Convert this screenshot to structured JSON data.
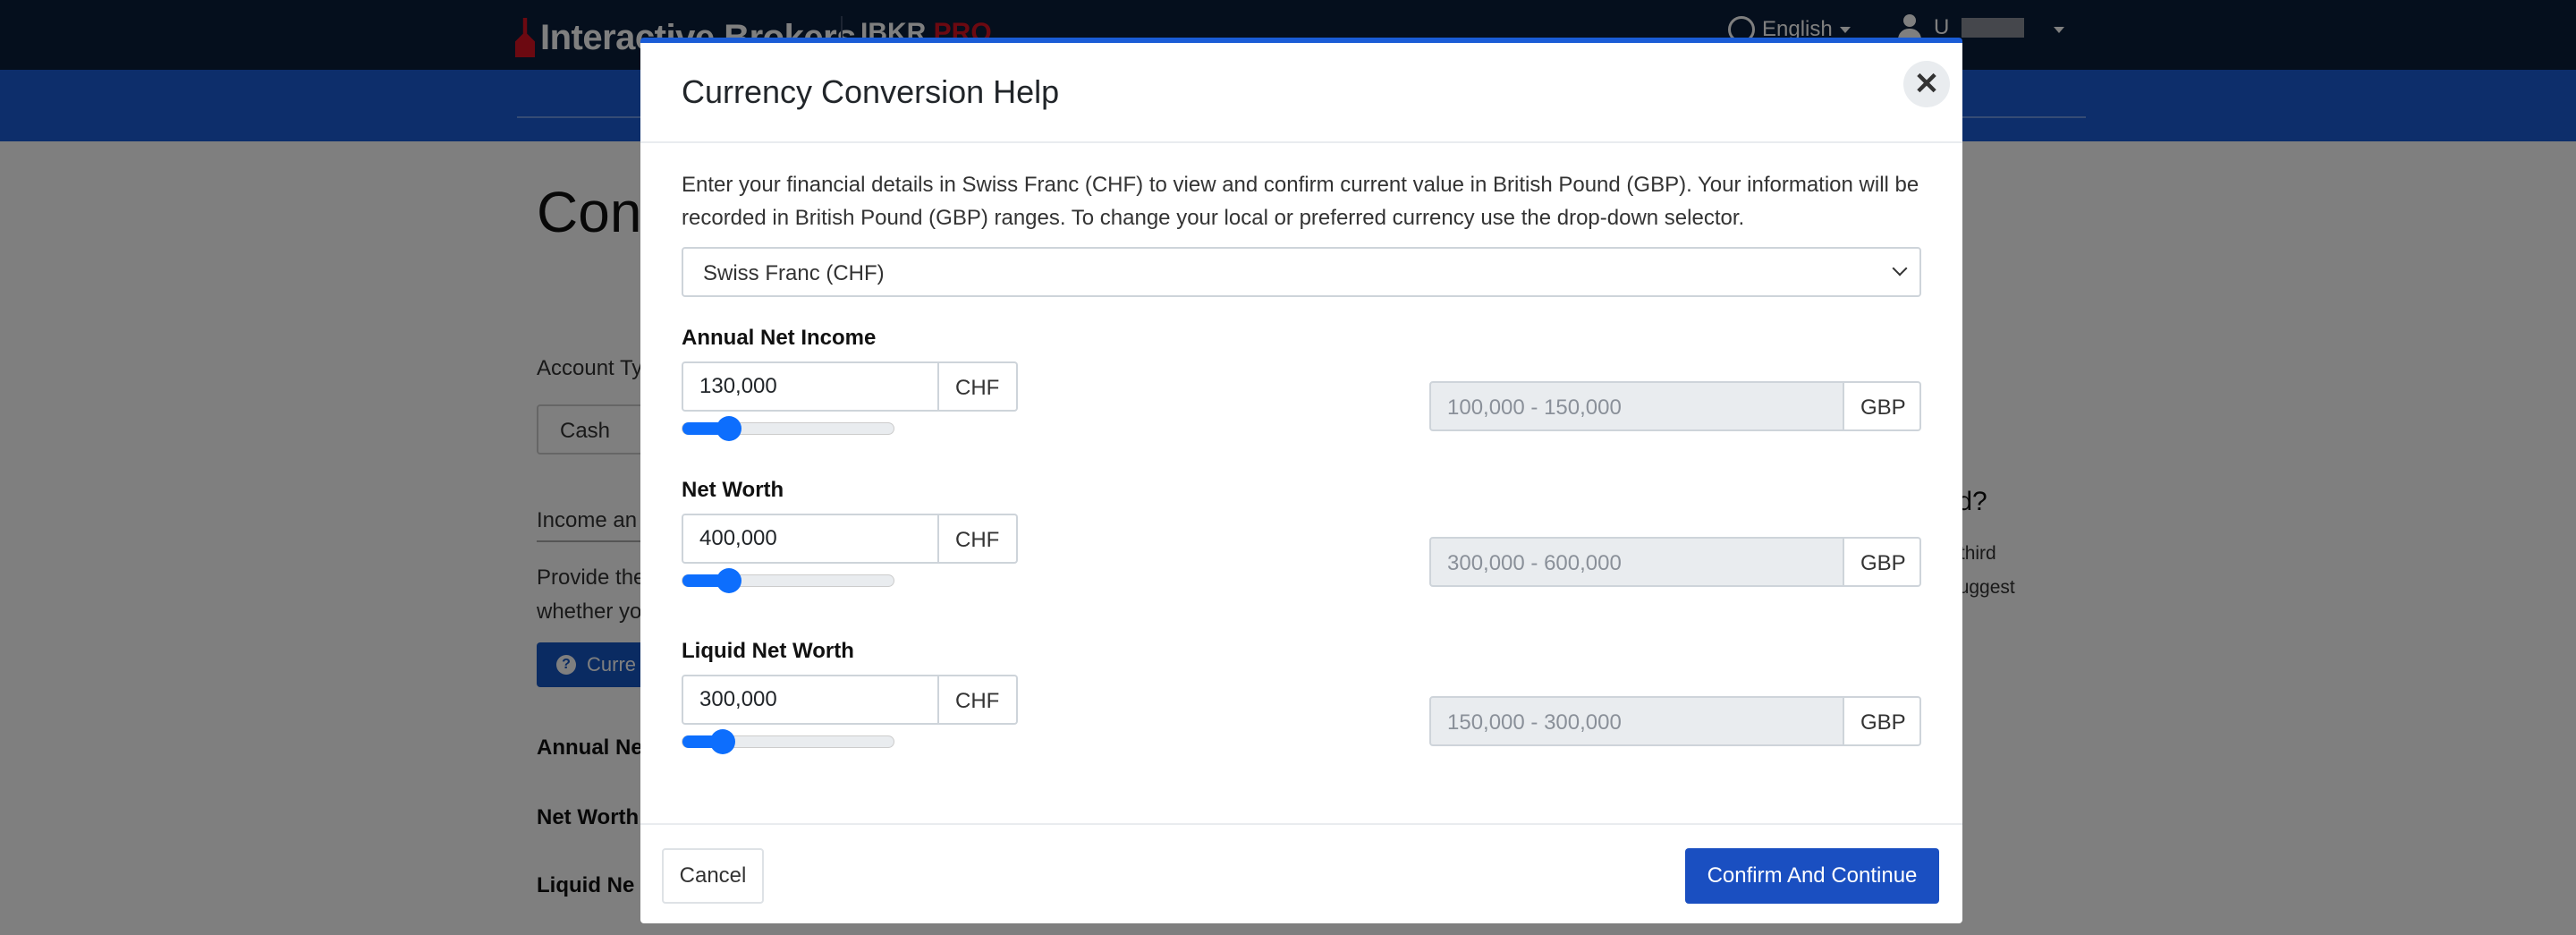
{
  "header": {
    "brand": "Interactive Brokers",
    "product_prefix": "IBKR ",
    "product_suffix": "PRO",
    "language": "English",
    "user_initial": "U"
  },
  "background": {
    "page_title": "Cont",
    "account_type_label": "Account Ty",
    "account_type_value": "Cash",
    "income_section": "Income an",
    "provide_text": "Provide the",
    "provide_text_2": "whether yo",
    "currency_button": "Curre",
    "annual_net": "Annual Ne",
    "net_worth": "Net Worth",
    "liquid_net": "Liquid Ne",
    "side_title": "sold?",
    "side_text_1": "n to third",
    "side_text_2": "nd suggest"
  },
  "modal": {
    "title": "Currency Conversion Help",
    "close_symbol": "✕",
    "intro": "Enter your financial details in Swiss Franc (CHF) to view and confirm current value in British Pound (GBP). Your information will be recorded in British Pound (GBP) ranges. To change your local or preferred currency use the drop-down selector.",
    "currency_selected": "Swiss Franc (CHF)",
    "fields": [
      {
        "label": "Annual Net Income",
        "value": "130,000",
        "unit": "CHF",
        "slider_fraction": 0.22,
        "range": "100,000 - 150,000",
        "range_unit": "GBP"
      },
      {
        "label": "Net Worth",
        "value": "400,000",
        "unit": "CHF",
        "slider_fraction": 0.22,
        "range": "300,000 - 600,000",
        "range_unit": "GBP"
      },
      {
        "label": "Liquid Net Worth",
        "value": "300,000",
        "unit": "CHF",
        "slider_fraction": 0.19,
        "range": "150,000 - 300,000",
        "range_unit": "GBP"
      }
    ],
    "cancel_label": "Cancel",
    "confirm_label": "Confirm And Continue"
  }
}
